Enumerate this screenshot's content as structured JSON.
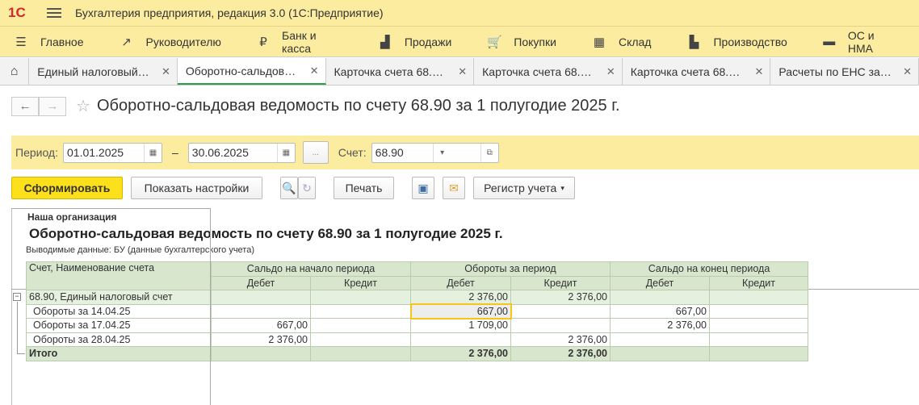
{
  "app": {
    "logo": "1С",
    "title": "Бухгалтерия предприятия, редакция 3.0  (1С:Предприятие)"
  },
  "menu": [
    {
      "icon": "menu-icon",
      "label": "Главное"
    },
    {
      "icon": "chart-icon",
      "label": "Руководителю"
    },
    {
      "icon": "ruble-icon",
      "label": "Банк и касса"
    },
    {
      "icon": "bag-icon",
      "label": "Продажи"
    },
    {
      "icon": "cart-icon",
      "label": "Покупки"
    },
    {
      "icon": "warehouse-icon",
      "label": "Склад"
    },
    {
      "icon": "factory-icon",
      "label": "Производство"
    },
    {
      "icon": "truck-icon",
      "label": "ОС и НМА"
    }
  ],
  "tabs": [
    "Единый налоговый…",
    "Оборотно-сальдов…",
    "Карточка счета 68.…",
    "Карточка счета 68.…",
    "Карточка счета 68.…",
    "Расчеты по ЕНС за…"
  ],
  "page_title": "Оборотно-сальдовая ведомость по счету 68.90 за 1 полугодие 2025 г.",
  "params": {
    "period_label": "Период:",
    "date_from": "01.01.2025",
    "dash": "–",
    "date_to": "30.06.2025",
    "more": "...",
    "account_label": "Счет:",
    "account": "68.90"
  },
  "toolbar": {
    "generate": "Сформировать",
    "settings": "Показать настройки",
    "print": "Печать",
    "register": "Регистр учета"
  },
  "report": {
    "org": "Наша организация",
    "title": "Оборотно-сальдовая ведомость по счету 68.90 за 1 полугодие 2025 г.",
    "output": "Выводимые данные: БУ (данные бухгалтерского учета)",
    "col_name": "Счет, Наименование счета",
    "groups": [
      "Сальдо на начало периода",
      "Обороты за период",
      "Сальдо на конец периода"
    ],
    "debit": "Дебет",
    "credit": "Кредит",
    "rows": [
      {
        "name": "68.90, Единый налоговый счет",
        "v": [
          "",
          "",
          "2 376,00",
          "2 376,00",
          "",
          ""
        ]
      },
      {
        "name": "Обороты за 14.04.25",
        "v": [
          "",
          "",
          "667,00",
          "",
          "667,00",
          ""
        ]
      },
      {
        "name": "Обороты за 17.04.25",
        "v": [
          "667,00",
          "",
          "1 709,00",
          "",
          "2 376,00",
          ""
        ]
      },
      {
        "name": "Обороты за 28.04.25",
        "v": [
          "2 376,00",
          "",
          "",
          "2 376,00",
          "",
          ""
        ]
      },
      {
        "name": "Итого",
        "v": [
          "",
          "",
          "2 376,00",
          "2 376,00",
          "",
          ""
        ]
      }
    ]
  }
}
